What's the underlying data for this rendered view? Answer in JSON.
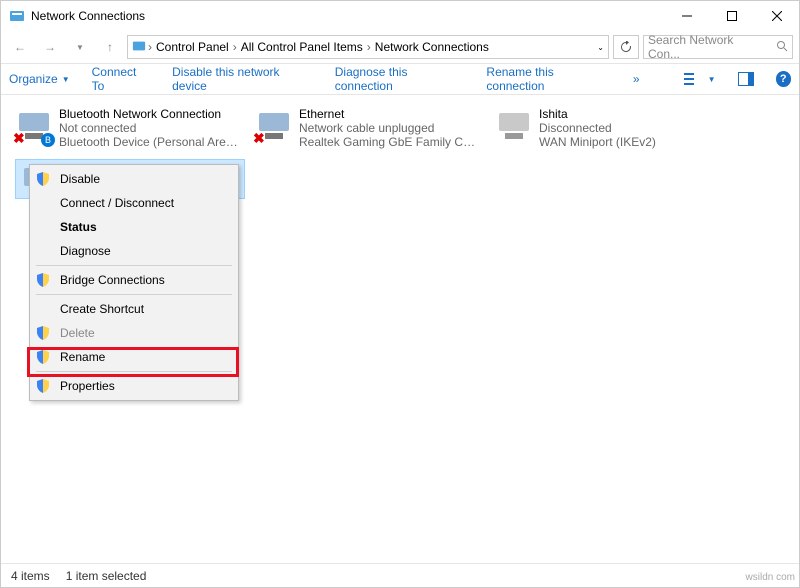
{
  "window": {
    "title": "Network Connections"
  },
  "breadcrumbs": [
    "Control Panel",
    "All Control Panel Items",
    "Network Connections"
  ],
  "search": {
    "placeholder": "Search Network Con..."
  },
  "toolbar": {
    "organize": "Organize",
    "connect": "Connect To",
    "disable": "Disable this network device",
    "diagnose": "Diagnose this connection",
    "rename": "Rename this connection"
  },
  "connections": [
    {
      "name": "Bluetooth Network Connection",
      "status": "Not connected",
      "device": "Bluetooth Device (Personal Area ..."
    },
    {
      "name": "Ethernet",
      "status": "Network cable unplugged",
      "device": "Realtek Gaming GbE Family Contr..."
    },
    {
      "name": "Ishita",
      "status": "Disconnected",
      "device": "WAN Miniport (IKEv2)"
    }
  ],
  "context_menu": {
    "disable": "Disable",
    "connect": "Connect / Disconnect",
    "status": "Status",
    "diagnose": "Diagnose",
    "bridge": "Bridge Connections",
    "shortcut": "Create Shortcut",
    "delete": "Delete",
    "rename": "Rename",
    "properties": "Properties"
  },
  "statusbar": {
    "count": "4 items",
    "selected": "1 item selected"
  },
  "watermark": "wsildn com"
}
